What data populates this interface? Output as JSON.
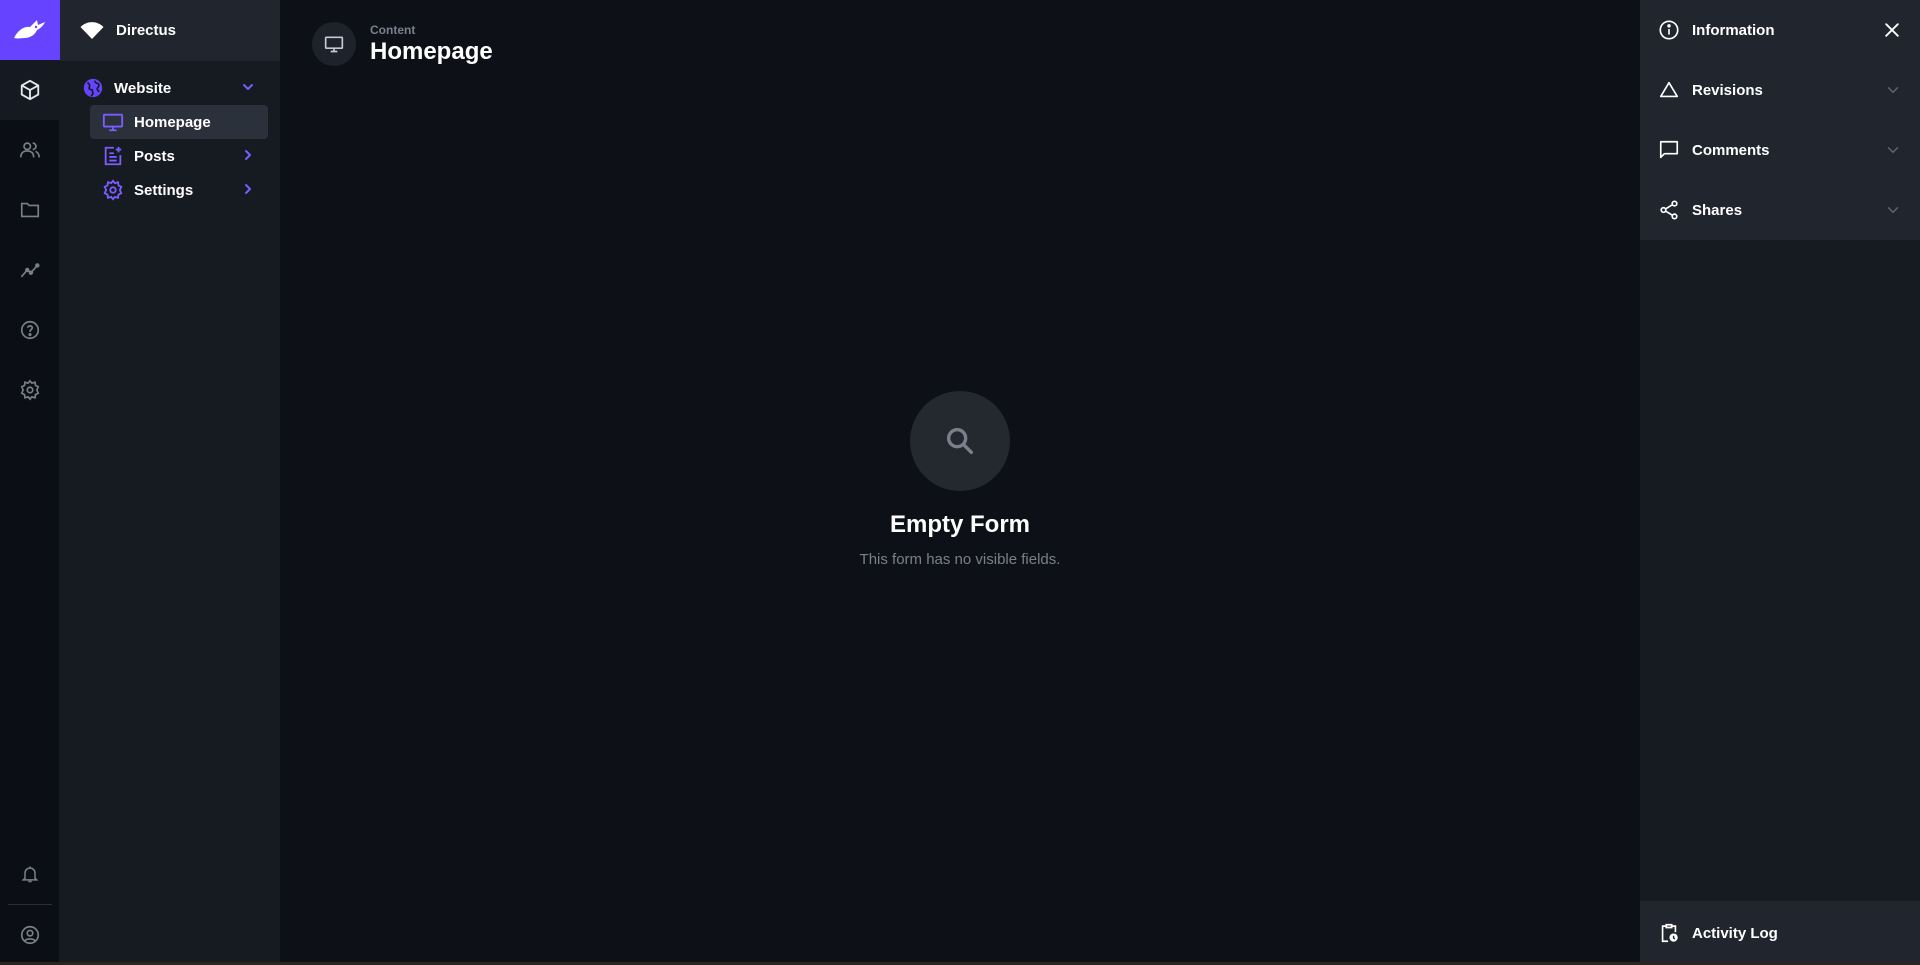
{
  "project": {
    "name": "Directus"
  },
  "nav": {
    "items": [
      {
        "label": "Website"
      },
      {
        "label": "Homepage"
      },
      {
        "label": "Posts"
      },
      {
        "label": "Settings"
      }
    ]
  },
  "header": {
    "breadcrumb": "Content",
    "title": "Homepage"
  },
  "empty_state": {
    "title": "Empty Form",
    "text": "This form has no visible fields."
  },
  "sidebar": {
    "items": [
      {
        "label": "Information"
      },
      {
        "label": "Revisions"
      },
      {
        "label": "Comments"
      },
      {
        "label": "Shares"
      }
    ],
    "activity_label": "Activity Log"
  },
  "colors": {
    "accent": "#6644ff",
    "background": "#0d1117",
    "panel": "#161b22"
  }
}
